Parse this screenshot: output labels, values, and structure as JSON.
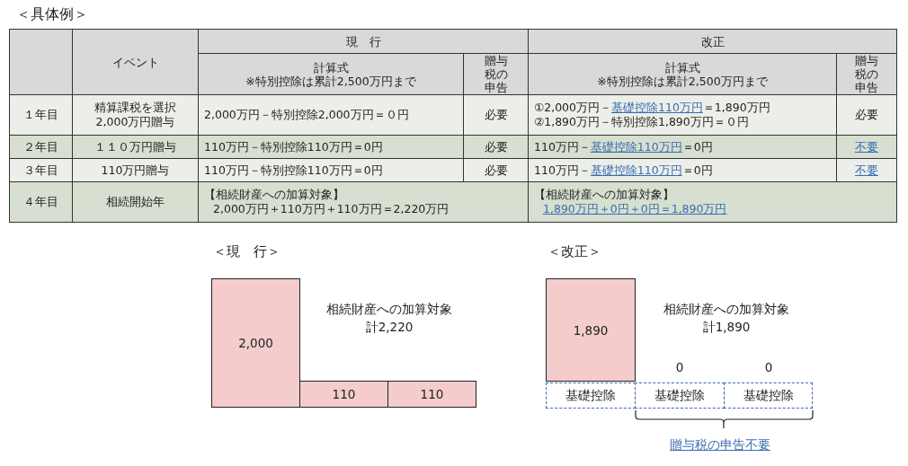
{
  "title": "＜具体例＞",
  "table": {
    "event_header": "イベント",
    "sections": [
      {
        "title": "現　行",
        "formula_header": "計算式",
        "formula_note": "※特別控除は累計2,500万円まで",
        "filing_header": "贈与税の申告"
      },
      {
        "title": "改正",
        "formula_header": "計算式",
        "formula_note": "※特別控除は累計2,500万円まで",
        "filing_header": "贈与税の申告"
      }
    ],
    "rows": [
      {
        "kind": "gift",
        "year": "１年目",
        "event": "精算課税を選択\n2,000万円贈与",
        "shaded": false,
        "current": {
          "formula": [
            [
              {
                "text": "2,000万円－特別控除2,000万円＝０円",
                "link": false
              }
            ]
          ],
          "filing": {
            "text": "必要",
            "link": false
          }
        },
        "revised": {
          "formula": [
            [
              {
                "text": "①2,000万円－",
                "link": false
              },
              {
                "text": "基礎控除110万円",
                "link": true
              },
              {
                "text": "＝1,890万円",
                "link": false
              }
            ],
            [
              {
                "text": "②1,890万円－特別控除1,890万円＝０円",
                "link": false
              }
            ]
          ],
          "filing": {
            "text": "必要",
            "link": false
          }
        }
      },
      {
        "kind": "gift",
        "year": "２年目",
        "event": "１１０万円贈与",
        "shaded": true,
        "current": {
          "formula": [
            [
              {
                "text": "110万円－特別控除110万円＝0円",
                "link": false
              }
            ]
          ],
          "filing": {
            "text": "必要",
            "link": false
          }
        },
        "revised": {
          "formula": [
            [
              {
                "text": "110万円－",
                "link": false
              },
              {
                "text": "基礎控除110万円",
                "link": true
              },
              {
                "text": "＝0円",
                "link": false
              }
            ]
          ],
          "filing": {
            "text": "不要",
            "link": true
          }
        }
      },
      {
        "kind": "gift",
        "year": "３年目",
        "event": "110万円贈与",
        "shaded": false,
        "current": {
          "formula": [
            [
              {
                "text": "110万円－特別控除110万円＝0円",
                "link": false
              }
            ]
          ],
          "filing": {
            "text": "必要",
            "link": false
          }
        },
        "revised": {
          "formula": [
            [
              {
                "text": "110万円－",
                "link": false
              },
              {
                "text": "基礎控除110万円",
                "link": true
              },
              {
                "text": "＝0円",
                "link": false
              }
            ]
          ],
          "filing": {
            "text": "不要",
            "link": true
          }
        }
      },
      {
        "kind": "summary",
        "year": "４年目",
        "event": "相続開始年",
        "shaded": true,
        "current": {
          "formula": [
            [
              {
                "text": "【相続財産への加算対象】",
                "link": false
              }
            ],
            [
              {
                "text": "2,000万円＋110万円＋110万円＝2,220万円",
                "link": false
              }
            ]
          ]
        },
        "revised": {
          "formula": [
            [
              {
                "text": "【相続財産への加算対象】",
                "link": false
              }
            ],
            [
              {
                "text": "1,890万円＋0円＋0円＝1,890万円",
                "link": true
              }
            ]
          ]
        }
      }
    ]
  },
  "diagrams": [
    {
      "kind": "current",
      "title": "＜現　行＞",
      "bars": [
        {
          "label": "2,000"
        },
        {
          "label": "110"
        },
        {
          "label": "110"
        }
      ],
      "caption": "相続財産への加算対象",
      "total": "計2,220"
    },
    {
      "kind": "revised",
      "title": "＜改正＞",
      "bars": [
        {
          "label": "1,890"
        },
        {
          "label": "0"
        },
        {
          "label": "0"
        }
      ],
      "deductions": [
        "基礎控除",
        "基礎控除",
        "基礎控除"
      ],
      "caption": "相続財産への加算対象",
      "total": "計1,890",
      "note": "贈与税の申告不要"
    }
  ]
}
